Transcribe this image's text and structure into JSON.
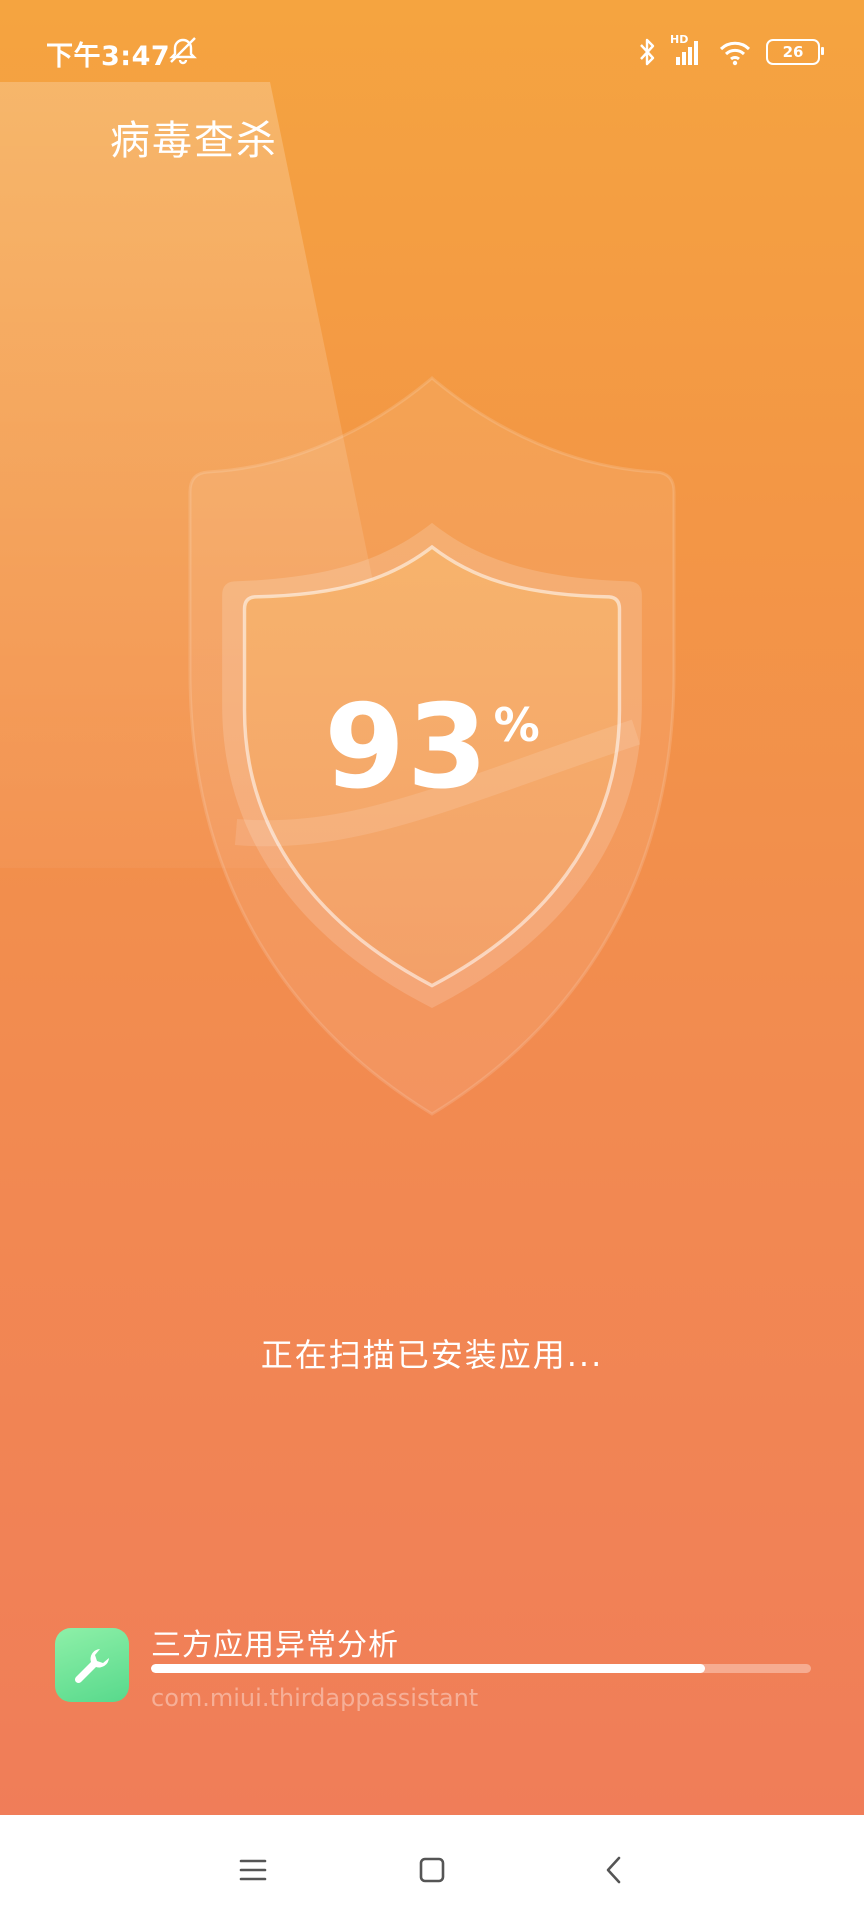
{
  "status_bar": {
    "time": "下午3:47",
    "network_label": "HD",
    "battery_level": "26",
    "icons": [
      "alarm-off-icon",
      "bluetooth-icon",
      "signal-icon",
      "wifi-icon",
      "battery-icon"
    ]
  },
  "header": {
    "title": "病毒查杀"
  },
  "scan": {
    "percent": "93",
    "percent_symbol": "%",
    "status_text": "正在扫描已安装应用..."
  },
  "task": {
    "name": "三方应用异常分析",
    "package": "com.miui.thirdappassistant",
    "progress": 0.84,
    "icon": "wrench-icon"
  },
  "nav_bar": {
    "buttons": [
      "menu-icon",
      "home-icon",
      "back-icon"
    ]
  },
  "colors": {
    "background_top": "#f5a440",
    "background_bottom": "#f07b5a",
    "task_icon": "#6ee39a",
    "nav_bar": "#ffffff"
  }
}
